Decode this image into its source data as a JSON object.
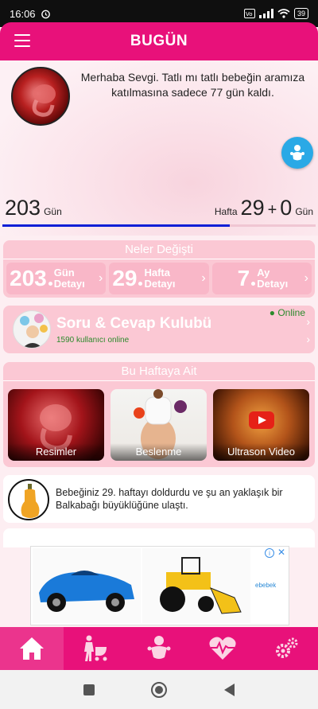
{
  "status_bar": {
    "time": "16:06",
    "battery": "39"
  },
  "app_bar": {
    "title": "BUGÜN"
  },
  "hero": {
    "greeting": "Merhaba Sevgi. Tatlı mı tatlı bebeğin aramıza katılmasına sadece 77 gün kaldı.",
    "days_value": "203",
    "days_unit": "Gün",
    "week_label": "Hafta",
    "week_value": "29",
    "plus": "+",
    "extra_days_value": "0",
    "extra_days_unit": "Gün",
    "progress_fraction": 0.725
  },
  "changes": {
    "header": "Neler Değişti",
    "stats": [
      {
        "value": "203",
        "label_top": "Gün",
        "label_bottom": "Detayı"
      },
      {
        "value": "29",
        "label_top": "Hafta",
        "label_bottom": "Detayı"
      },
      {
        "value": "7",
        "label_top": "Ay",
        "label_bottom": "Detayı"
      }
    ]
  },
  "club": {
    "title": "Soru & Cevap Kulubü",
    "users": "1590 kullanıcı online",
    "online_label": "Online"
  },
  "this_week": {
    "header": "Bu Haftaya Ait",
    "tiles": [
      {
        "label": "Resimler"
      },
      {
        "label": "Beslenme"
      },
      {
        "label": "Ultrason Video"
      }
    ]
  },
  "size_info": {
    "text": "Bebeğiniz 29. haftayı doldurdu ve şu an yaklaşık bir Balkabağı büyüklüğüne ulaştı."
  },
  "ad": {
    "brand": "ebebek"
  },
  "icons": {
    "menu": "hamburger-icon",
    "baby_fab": "baby-icon",
    "nav": [
      "home-icon",
      "mother-stroller-icon",
      "baby-icon",
      "heart-pulse-icon",
      "gears-icon"
    ]
  },
  "colors": {
    "primary": "#e8117a",
    "card_pink": "#fbc8d4",
    "progress": "#0c1fd6",
    "online_green": "#2b8a2b",
    "fab_blue": "#2aa9e6"
  }
}
